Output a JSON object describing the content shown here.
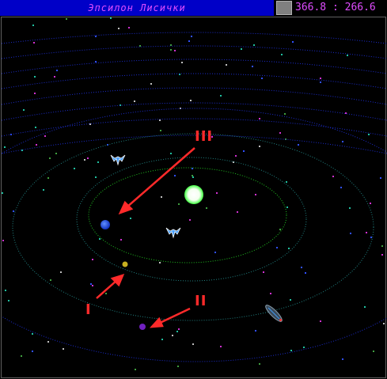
{
  "header": {
    "system_name": "Эпсилон Лисички",
    "coordinates": "366.8 : 266.6"
  },
  "annotations": {
    "label_1": "I",
    "label_2": "II",
    "label_3": "III"
  },
  "colors": {
    "title_bg": "#0000c8",
    "title_text": "#e04cff",
    "orbit_green": "#20c020",
    "orbit_teal": "#208080",
    "grid_blue": "#1c2ccc",
    "arrow_red": "#ff2a2a"
  }
}
